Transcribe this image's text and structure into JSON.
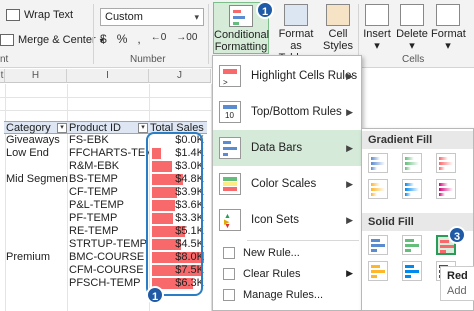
{
  "ribbon": {
    "wrap_text": "Wrap Text",
    "merge_center": "Merge & Center",
    "number_format": "Custom",
    "number_icons": [
      "$",
      "%",
      ",",
      "←0",
      "→00"
    ],
    "group_number": "Number",
    "group_cells": "Cells",
    "conditional_formatting": [
      "Conditional",
      "Formatting"
    ],
    "format_as_table": [
      "Format as",
      "Table"
    ],
    "cell_styles": [
      "Cell",
      "Styles"
    ],
    "insert": "Insert",
    "delete": "Delete",
    "format": "Format",
    "cf_badge": "1"
  },
  "columns": [
    "H",
    "I",
    "J"
  ],
  "column_clip": "t",
  "pivot": {
    "headers": [
      "Category",
      "Product ID",
      "Total Sales"
    ],
    "rows": [
      {
        "category": "Giveaways",
        "product": "FS-EBK",
        "sales": "$0.0K",
        "value": 0.0
      },
      {
        "category": "Low End",
        "product": "FFCHARTS-TEMP",
        "sales": "$1.4K",
        "value": 1.4
      },
      {
        "category": "",
        "product": "R&M-EBK",
        "sales": "$3.0K",
        "value": 3.0
      },
      {
        "category": "Mid Segment",
        "product": "BS-TEMP",
        "sales": "$4.8K",
        "value": 4.8
      },
      {
        "category": "",
        "product": "CF-TEMP",
        "sales": "$3.9K",
        "value": 3.9
      },
      {
        "category": "",
        "product": "P&L-TEMP",
        "sales": "$3.6K",
        "value": 3.6
      },
      {
        "category": "",
        "product": "PF-TEMP",
        "sales": "$3.3K",
        "value": 3.3
      },
      {
        "category": "",
        "product": "RE-TEMP",
        "sales": "$5.1K",
        "value": 5.1
      },
      {
        "category": "",
        "product": "STRTUP-TEMP",
        "sales": "$4.5K",
        "value": 4.5
      },
      {
        "category": "Premium",
        "product": "BMC-COURSE",
        "sales": "$8.0K",
        "value": 8.0
      },
      {
        "category": "",
        "product": "CFM-COURSE",
        "sales": "$7.5K",
        "value": 7.5
      },
      {
        "category": "",
        "product": "PFSCH-TEMP",
        "sales": "$6.3K",
        "value": 6.3
      }
    ],
    "bar_color": "#f8696b",
    "selection_badge": "1"
  },
  "menu": {
    "items": [
      {
        "label": "Highlight Cells Rules",
        "underline": "H"
      },
      {
        "label": "Top/Bottom Rules",
        "underline": "T"
      },
      {
        "label": "Data Bars",
        "underline": "D"
      },
      {
        "label": "Color Scales",
        "underline": "S"
      },
      {
        "label": "Icon Sets",
        "underline": "I"
      }
    ],
    "small_items": [
      "New Rule...",
      "Clear Rules",
      "Manage Rules..."
    ],
    "highlight_color": "#d5ead9"
  },
  "submenu": {
    "gradient_header": "Gradient Fill",
    "solid_header": "Solid Fill",
    "colors": [
      "#5b8bd0",
      "#63be7b",
      "#f8696b",
      "#ffb628",
      "#008aef",
      "#d6007b"
    ],
    "selected_badge": "3",
    "tooltip": [
      "Red",
      "Add"
    ]
  }
}
